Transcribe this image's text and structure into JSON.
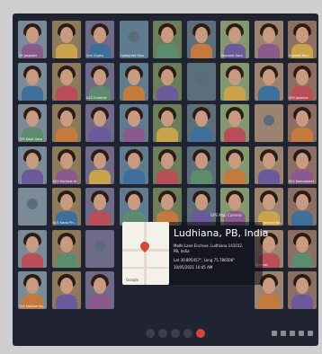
{
  "tiles": [
    "25 Jaspreet",
    "",
    "Urvi Gupta",
    "Sukhpreet Kaur",
    "",
    "",
    "Navneet Kaur",
    "",
    "Supreet Kaur",
    "",
    "",
    "A23 Gurkirat",
    "",
    "",
    "",
    "",
    "",
    "005 Jasmine",
    "135 Kajal Garg",
    "",
    "",
    "",
    "",
    "",
    "",
    "",
    "",
    "",
    "A23 Gurkirat Kr",
    "",
    "",
    "",
    "",
    "",
    "",
    "002 Kamalpreet",
    "",
    "A14 Kavia Ph...",
    "",
    "",
    "",
    "",
    "",
    "F03 Navneet Ka...",
    "",
    "",
    "",
    "",
    "",
    "",
    "",
    "",
    "Gurkirat",
    "",
    "124 Sukhbir Ka...",
    "",
    "",
    "",
    "",
    "",
    "",
    "",
    ""
  ],
  "gps": {
    "app_label": "GPS Map Camera",
    "title": "Ludhiana, PB, India",
    "address": "Malhi Lane Enclave, Ludhiana 141012,",
    "region": "PB, India",
    "coords": "Lat 30.895457°, Long 75.786506°",
    "datetime": "10/05/2021 10:45 AM",
    "map_label": "Google"
  }
}
